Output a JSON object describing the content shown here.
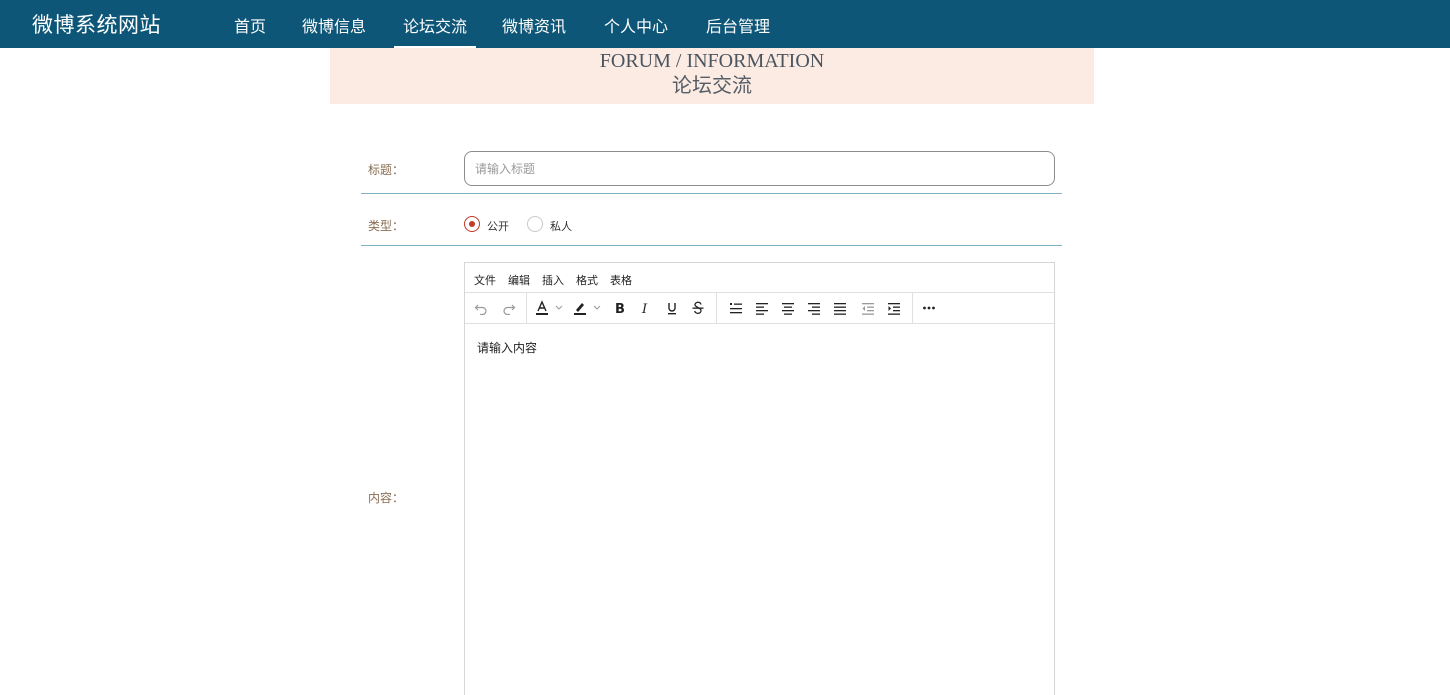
{
  "app": {
    "brand": "微博系统网站"
  },
  "nav": {
    "items": [
      {
        "label": "首页"
      },
      {
        "label": "微博信息"
      },
      {
        "label": "论坛交流"
      },
      {
        "label": "微博资讯"
      },
      {
        "label": "个人中心"
      },
      {
        "label": "后台管理"
      }
    ],
    "active": "论坛交流"
  },
  "banner": {
    "en": "FORUM / INFORMATION",
    "zh": "论坛交流"
  },
  "form": {
    "title_label": "标题：",
    "title_placeholder": "请输入标题",
    "title_value": "",
    "type_label": "类型：",
    "type_options": [
      "公开",
      "私人"
    ],
    "type_selected": "公开",
    "content_label": "内容："
  },
  "editor": {
    "menu": [
      "文件",
      "编辑",
      "插入",
      "格式",
      "表格"
    ],
    "content_placeholder": "请输入内容",
    "accent_color": "#c0392b"
  },
  "colors": {
    "nav_bg": "#0d5677",
    "banner_bg": "#fbebe3",
    "label": "#8a6e54",
    "divider": "#7fb3c2"
  }
}
